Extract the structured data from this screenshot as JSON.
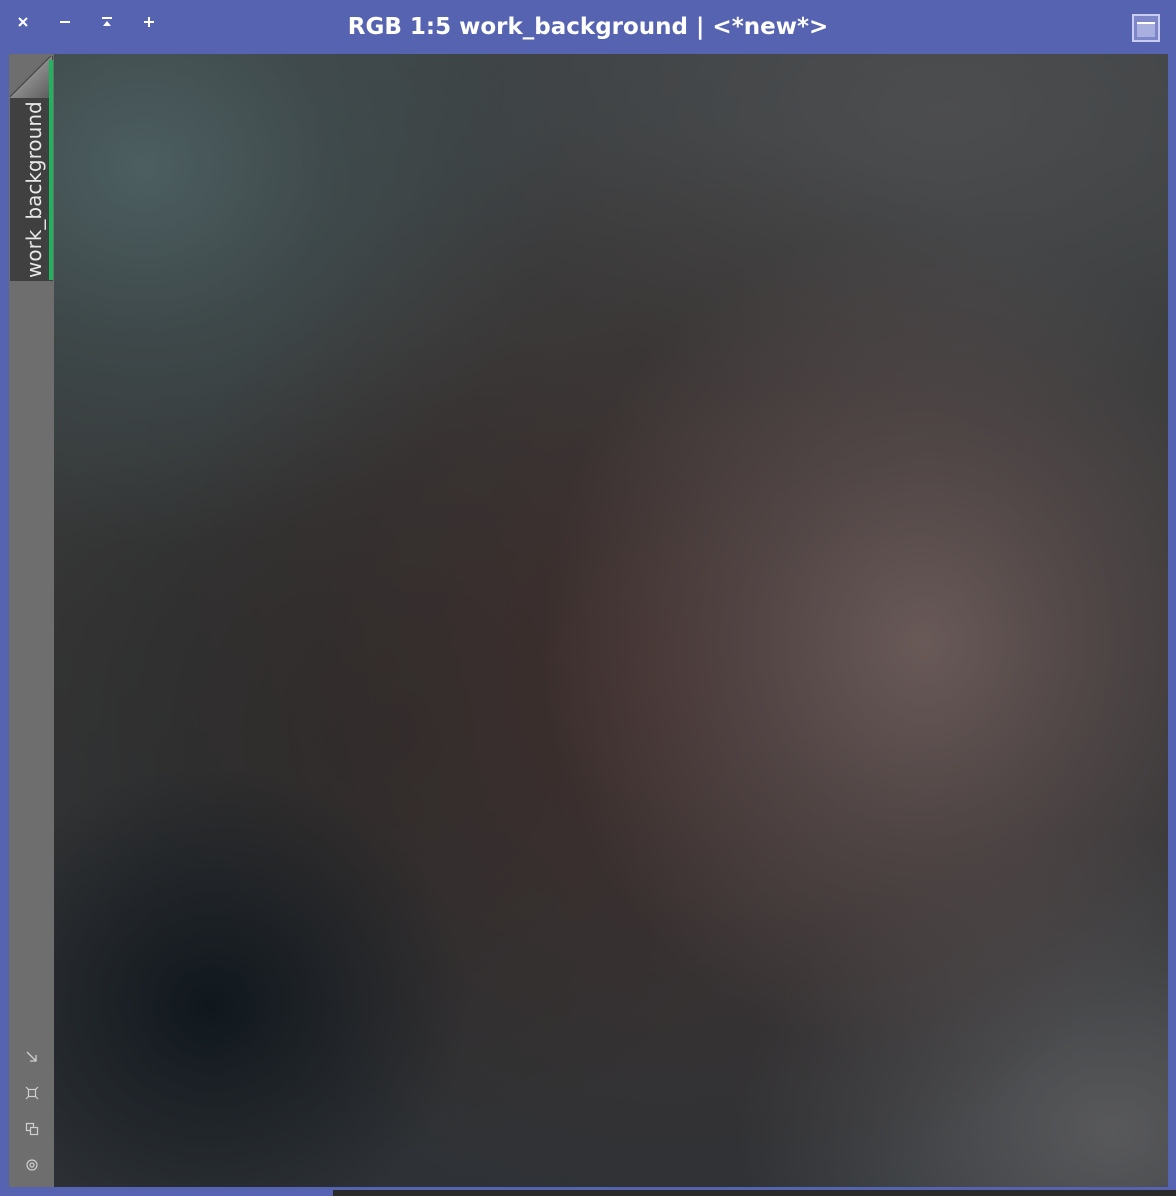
{
  "window": {
    "title": "RGB 1:5 work_background | <*new*>",
    "title_color": "#ffffff",
    "frame_color": "#5663b0"
  },
  "titlebar_buttons": [
    {
      "name": "close",
      "icon": "close-icon"
    },
    {
      "name": "minimize",
      "icon": "minimize-icon"
    },
    {
      "name": "iconize",
      "icon": "iconize-icon"
    },
    {
      "name": "maximize",
      "icon": "maximize-icon"
    }
  ],
  "view_tab": {
    "label": "work_background",
    "accent_color": "#1db35f"
  },
  "side_tools": [
    {
      "name": "zoom-to-fit",
      "icon": "arrow-down-right-icon"
    },
    {
      "name": "fit-view",
      "icon": "fit-frame-icon"
    },
    {
      "name": "clone-view",
      "icon": "copy-icon"
    },
    {
      "name": "target",
      "icon": "target-icon"
    }
  ]
}
